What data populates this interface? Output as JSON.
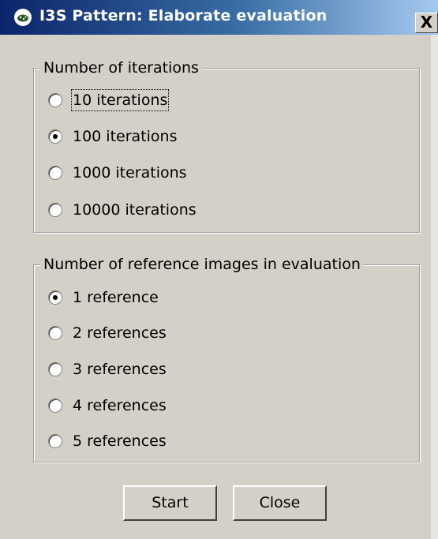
{
  "window": {
    "title": "I3S Pattern: Elaborate evaluation",
    "close_label": "X"
  },
  "iterations_group": {
    "title": "Number of iterations",
    "options": [
      {
        "label": "10 iterations",
        "selected": false
      },
      {
        "label": "100 iterations",
        "selected": true
      },
      {
        "label": "1000 iterations",
        "selected": false
      },
      {
        "label": "10000 iterations",
        "selected": false
      }
    ]
  },
  "references_group": {
    "title": "Number of reference images in evaluation",
    "options": [
      {
        "label": "1 reference",
        "selected": true
      },
      {
        "label": "2 references",
        "selected": false
      },
      {
        "label": "3 references",
        "selected": false
      },
      {
        "label": "4 references",
        "selected": false
      },
      {
        "label": "5 references",
        "selected": false
      }
    ]
  },
  "buttons": {
    "start_label": "Start",
    "close_label": "Close"
  }
}
